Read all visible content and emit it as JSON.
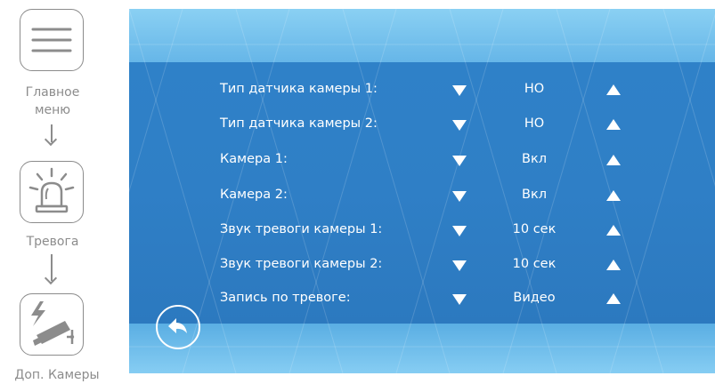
{
  "nav": {
    "steps": [
      {
        "label": "Главное\nменю",
        "icon": "menu-icon"
      },
      {
        "label": "Тревога",
        "icon": "alarm-beacon-icon"
      },
      {
        "label": "Доп. Камеры",
        "icon": "camera-lightning-icon"
      }
    ]
  },
  "settings": {
    "rows": [
      {
        "label": "Тип датчика камеры 1:",
        "value": "НО"
      },
      {
        "label": "Тип датчика камеры 2:",
        "value": "НО"
      },
      {
        "label": "Камера 1:",
        "value": "Вкл"
      },
      {
        "label": "Камера 2:",
        "value": "Вкл"
      },
      {
        "label": "Звук тревоги камеры 1:",
        "value": "10 сек"
      },
      {
        "label": "Звук тревоги камеры 2:",
        "value": "10 сек"
      },
      {
        "label": "Запись по тревоге:",
        "value": "Видео"
      }
    ]
  },
  "colors": {
    "panel_main": "#2f7fc6",
    "panel_light": "#86cdf3",
    "text": "#ffffff",
    "nav_gray": "#8c8c8c"
  }
}
